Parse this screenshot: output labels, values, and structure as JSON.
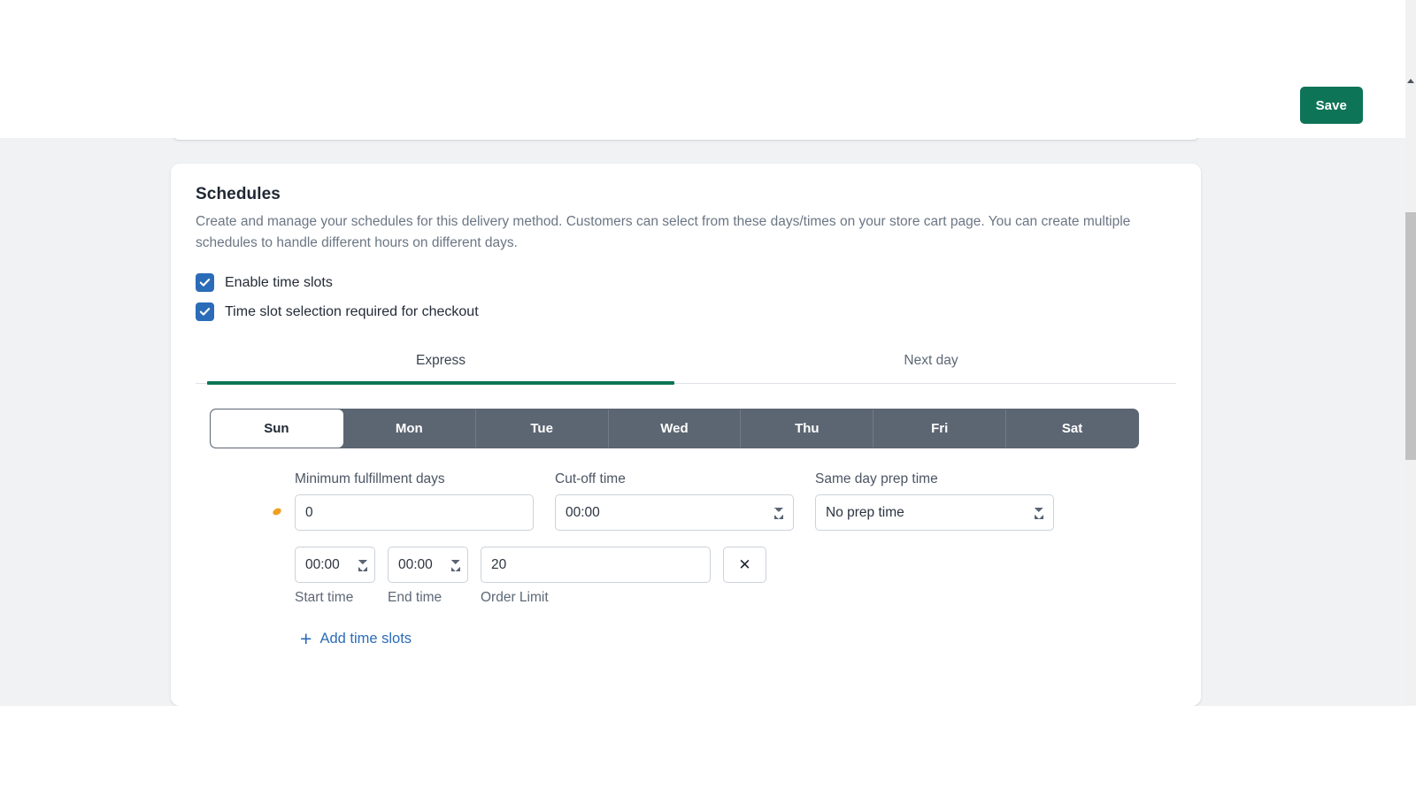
{
  "topbar": {
    "save_label": "Save"
  },
  "card": {
    "title": "Schedules",
    "description": "Create and manage your schedules for this delivery method. Customers can select from these days/times on your store cart page. You can create multiple schedules to handle different hours on different days."
  },
  "checkboxes": [
    {
      "label": "Enable time slots",
      "checked": true
    },
    {
      "label": "Time slot selection required for checkout",
      "checked": true
    }
  ],
  "tabs": [
    {
      "label": "Express",
      "active": true
    },
    {
      "label": "Next day",
      "active": false
    }
  ],
  "days": [
    {
      "label": "Sun",
      "active": true
    },
    {
      "label": "Mon",
      "active": false
    },
    {
      "label": "Tue",
      "active": false
    },
    {
      "label": "Wed",
      "active": false
    },
    {
      "label": "Thu",
      "active": false
    },
    {
      "label": "Fri",
      "active": false
    },
    {
      "label": "Sat",
      "active": false
    }
  ],
  "settings": {
    "min_days": {
      "label": "Minimum fulfillment days",
      "value": "0"
    },
    "cutoff": {
      "label": "Cut-off time",
      "value": "00:00"
    },
    "prep": {
      "label": "Same day prep time",
      "value": "No prep time"
    }
  },
  "slots": [
    {
      "start_time": {
        "caption": "Start time",
        "value": "00:00"
      },
      "end_time": {
        "caption": "End time",
        "value": "00:00"
      },
      "order_limit": {
        "caption": "Order Limit",
        "value": "20"
      },
      "remove_label": "✕"
    }
  ],
  "add_link": {
    "plus": "+",
    "label": "Add time slots"
  },
  "colors": {
    "accent_green": "#0e7457",
    "tab_underline": "#0e7556",
    "checkbox_blue": "#2b6cb8",
    "link_blue": "#2b6cb8",
    "daybar_gray": "#5c6672",
    "page_bg": "#f1f2f3",
    "cursor_orange": "#f0a020"
  }
}
